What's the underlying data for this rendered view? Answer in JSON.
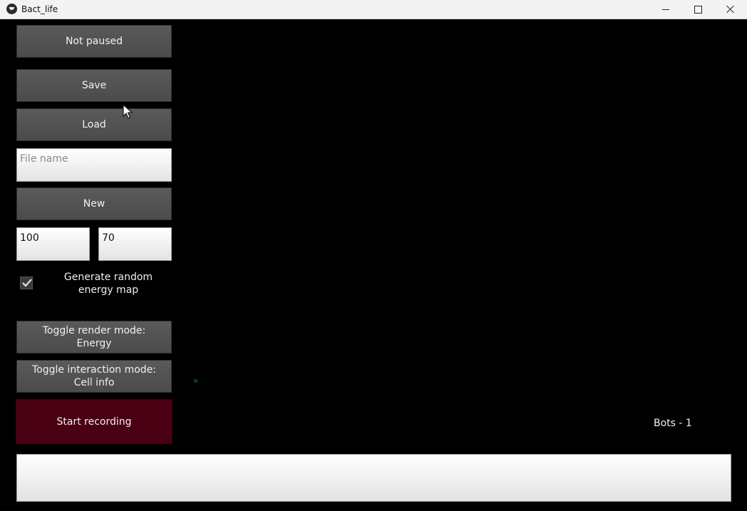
{
  "window": {
    "title": "Bact_life"
  },
  "controls": {
    "pause_label": "Not paused",
    "save_label": "Save",
    "load_label": "Load",
    "file_name": {
      "value": "",
      "placeholder": "File name"
    },
    "new_label": "New",
    "width_value": "100",
    "height_value": "70",
    "random_energy": {
      "checked": true,
      "label": "Generate random\n energy map"
    },
    "render_mode_label": "Toggle render mode:\nEnergy",
    "interaction_mode_label": "Toggle interaction mode:\nCell info",
    "record_label": "Start recording"
  },
  "status": {
    "bots_text": "Bots - 1"
  },
  "colors": {
    "record_button": "#4a0013",
    "button": "#505050",
    "background": "#000000",
    "cell": "#0d3a16"
  }
}
